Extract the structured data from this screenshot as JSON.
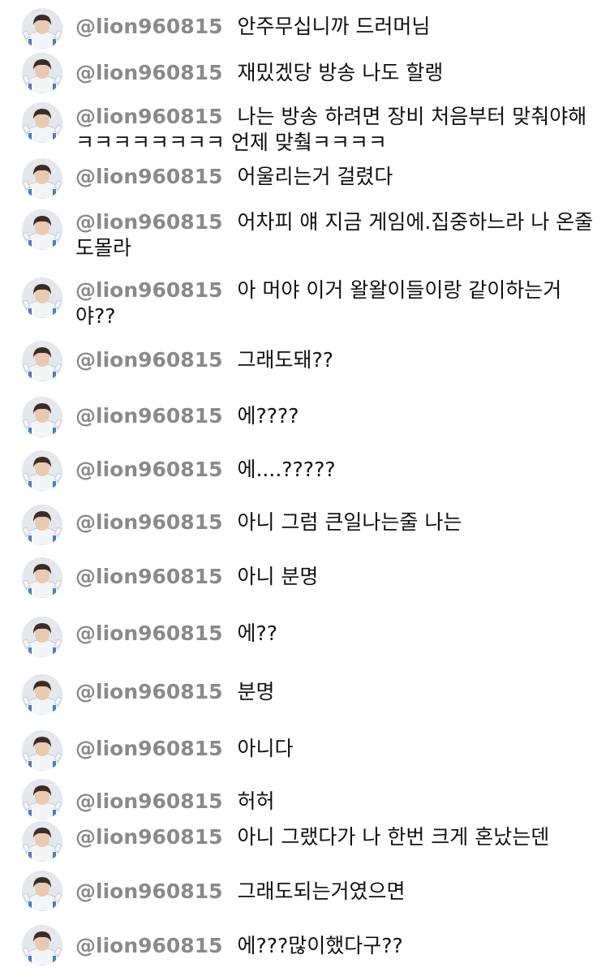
{
  "comments": [
    {
      "user": "@lion960815",
      "text": "안주무십니까 드러머님"
    },
    {
      "user": "@lion960815",
      "text": "재밌겠당 방송 나도 할랭"
    },
    {
      "user": "@lion960815",
      "text": "나는 방송 하려면 장비 처음부터 맞춰야해 ㅋㅋㅋㅋㅋㅋㅋㅋ 언제 맞췈ㅋㅋㅋㅋ"
    },
    {
      "user": "@lion960815",
      "text": "어울리는거 걸렸다"
    },
    {
      "user": "@lion960815",
      "text": "어차피 얘 지금 게임에.집중하느라 나 온줄도몰라"
    },
    {
      "user": "@lion960815",
      "text": "아 머야 이거 왈왈이들이랑 같이하는거야??"
    },
    {
      "user": "@lion960815",
      "text": "그래도돼??"
    },
    {
      "user": "@lion960815",
      "text": "에????"
    },
    {
      "user": "@lion960815",
      "text": "에....?????"
    },
    {
      "user": "@lion960815",
      "text": "아니 그럼 큰일나는줄 나는"
    },
    {
      "user": "@lion960815",
      "text": "아니 분명"
    },
    {
      "user": "@lion960815",
      "text": "에??"
    },
    {
      "user": "@lion960815",
      "text": "분명"
    },
    {
      "user": "@lion960815",
      "text": "아니다"
    },
    {
      "user": "@lion960815",
      "text": "허허"
    },
    {
      "user": "@lion960815",
      "text": "아니 그랬다가 나 한번 크게 혼났는덴"
    },
    {
      "user": "@lion960815",
      "text": "그래도되는거였으면"
    },
    {
      "user": "@lion960815",
      "text": "에???많이했다구??"
    }
  ]
}
